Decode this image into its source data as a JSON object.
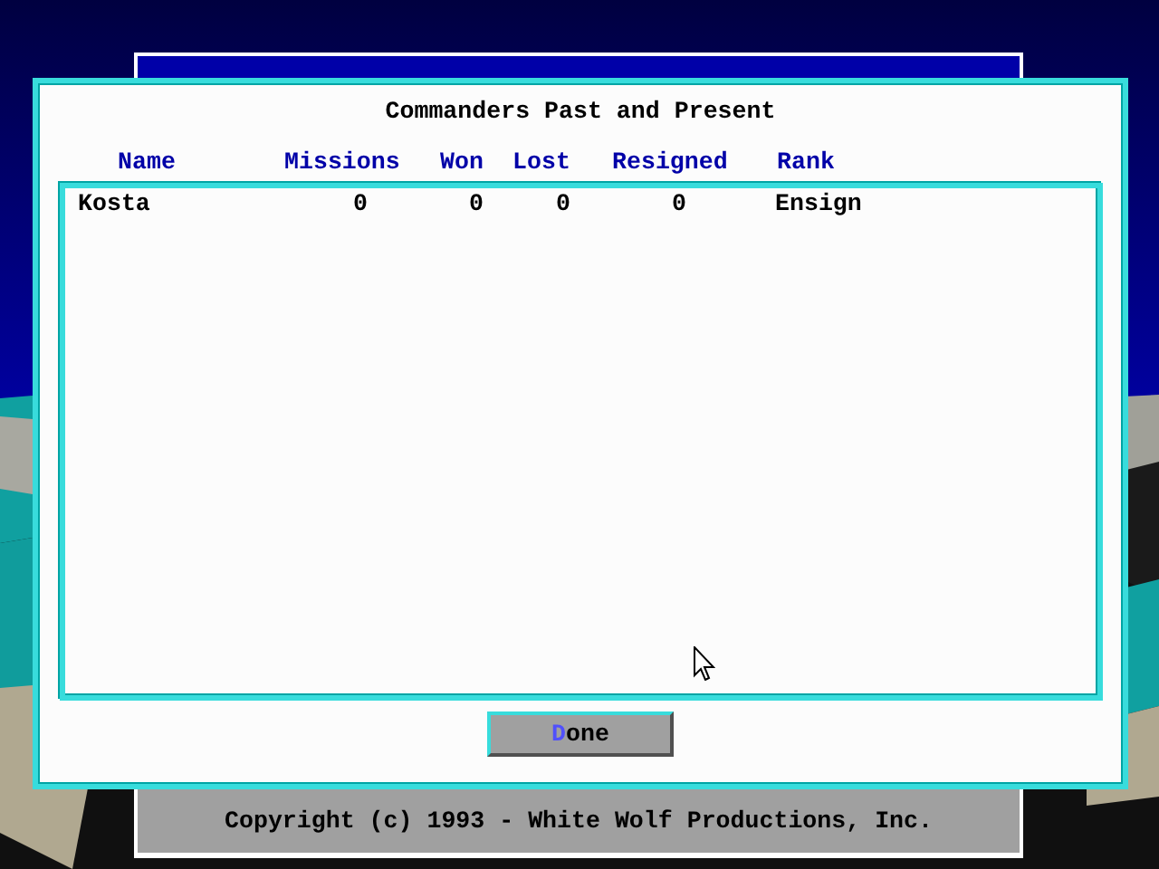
{
  "footer": {
    "text": "Copyright (c) 1993 - White Wolf Productions, Inc."
  },
  "dialog": {
    "title": "Commanders Past and Present",
    "columns": [
      "Name",
      "Missions",
      "Won",
      "Lost",
      "Resigned",
      "Rank"
    ],
    "rows": [
      {
        "cells": [
          "Kosta",
          "0",
          "0",
          "0",
          "0",
          "Ensign"
        ]
      }
    ],
    "done_button": {
      "label": "Done",
      "hotkey_highlighted": true
    }
  }
}
